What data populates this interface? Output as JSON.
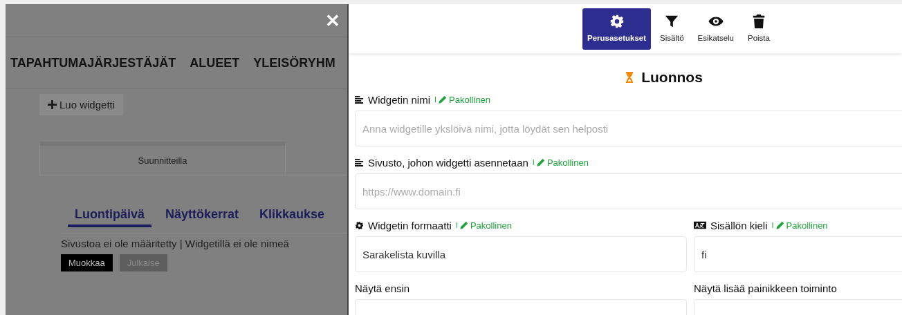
{
  "background": {
    "close_symbol": "✕",
    "nav_items": [
      "TAPAHTUMAJÄRJESTÄJÄT",
      "ALUEET",
      "YLEISÖRYHM"
    ],
    "create_button": {
      "label": "Luo widgetti"
    },
    "tabs": [
      {
        "label": "Suunnitteilla",
        "selected": true
      }
    ],
    "sort_tabs": [
      {
        "label": "Luontipäivä",
        "selected": true
      },
      {
        "label": "Näyttökerrat",
        "selected": false
      },
      {
        "label": "Klikkaukse",
        "selected": false
      }
    ],
    "widget_item": {
      "description": "Sivustoa ei ole määritetty | Widgetillä ei ole nimeä",
      "buttons": [
        {
          "label": "Muokkaa",
          "disabled": false
        },
        {
          "label": "Julkaise",
          "disabled": true
        }
      ]
    }
  },
  "panel": {
    "toolbar": [
      {
        "label": "Perusasetukset",
        "kind": "gear",
        "selected": true
      },
      {
        "label": "Sisältö",
        "kind": "filter",
        "selected": false
      },
      {
        "label": "Esikatselu",
        "kind": "eye",
        "selected": false
      },
      {
        "label": "Poista",
        "kind": "trash",
        "selected": false
      }
    ],
    "status": {
      "label": "Luonnos"
    },
    "rows": [
      [
        {
          "label": "Widgetin nimi",
          "kind": "lines",
          "separator": "I",
          "required": "Pakollinen",
          "placeholder": "Anna widgetille ykslöivä nimi, jotta löydät sen helposti"
        }
      ],
      [
        {
          "label": "Sivusto, johon widgetti asennetaan",
          "kind": "lines",
          "separator": "I",
          "required": "Pakollinen",
          "placeholder": "https://www.domain.fi"
        }
      ],
      [
        {
          "label": "Widgetin formaatti",
          "kind": "gear",
          "separator": "I",
          "required": "Pakollinen",
          "value": "Sarakelista kuvilla"
        },
        {
          "label": "Sisällön kieli",
          "kind": "language",
          "separator": "I",
          "required": "Pakollinen",
          "value": "fi"
        }
      ],
      [
        {
          "label": "Näytä ensin"
        },
        {
          "label": "Näytä lisää painikkeen toiminto"
        }
      ]
    ]
  }
}
